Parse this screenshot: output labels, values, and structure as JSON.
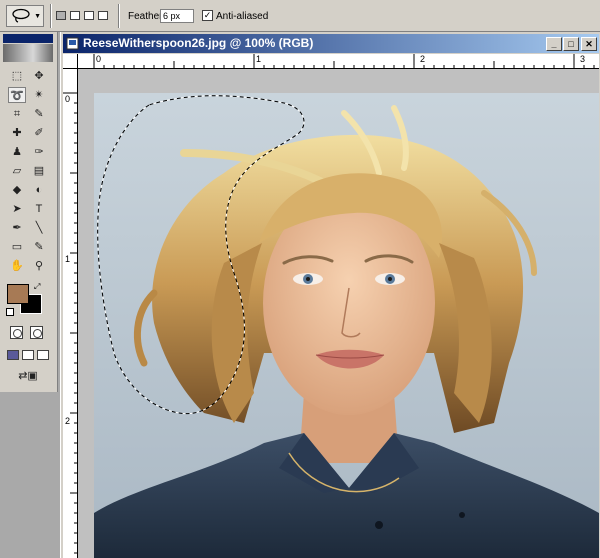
{
  "options_bar": {
    "feather_label": "Feather:",
    "feather_value": "6 px",
    "anti_aliased_label": "Anti-aliased",
    "anti_aliased_checked": true,
    "selection_modes": [
      "new-selection",
      "add-to-selection",
      "subtract-from-selection",
      "intersect-selection"
    ],
    "active_selection_mode": 0
  },
  "toolbox": {
    "tools": [
      {
        "name": "rectangular-marquee-tool",
        "glyph": "⬚"
      },
      {
        "name": "move-tool",
        "glyph": "✥"
      },
      {
        "name": "lasso-tool",
        "glyph": "➰"
      },
      {
        "name": "magic-wand-tool",
        "glyph": "✴"
      },
      {
        "name": "crop-tool",
        "glyph": "⌗"
      },
      {
        "name": "slice-tool",
        "glyph": "✎"
      },
      {
        "name": "healing-brush-tool",
        "glyph": "✚"
      },
      {
        "name": "brush-tool",
        "glyph": "✐"
      },
      {
        "name": "clone-stamp-tool",
        "glyph": "♟"
      },
      {
        "name": "history-brush-tool",
        "glyph": "✑"
      },
      {
        "name": "eraser-tool",
        "glyph": "▱"
      },
      {
        "name": "gradient-tool",
        "glyph": "▤"
      },
      {
        "name": "blur-tool",
        "glyph": "◆"
      },
      {
        "name": "dodge-tool",
        "glyph": "◐"
      },
      {
        "name": "path-selection-tool",
        "glyph": "➤"
      },
      {
        "name": "type-tool",
        "glyph": "T"
      },
      {
        "name": "pen-tool",
        "glyph": "✒"
      },
      {
        "name": "line-tool",
        "glyph": "╲"
      },
      {
        "name": "notes-tool",
        "glyph": "▭"
      },
      {
        "name": "eyedropper-tool",
        "glyph": "✎"
      },
      {
        "name": "hand-tool",
        "glyph": "✋"
      },
      {
        "name": "zoom-tool",
        "glyph": "⚲"
      }
    ],
    "selected_tool": "lasso-tool",
    "foreground_color": "#a77a55",
    "background_color": "#000000"
  },
  "document": {
    "title": "ReeseWitherspoon26.jpg @ 100% (RGB)",
    "minimize_glyph": "_",
    "maximize_glyph": "□",
    "close_glyph": "✕",
    "ruler_h_labels": [
      "0",
      "1",
      "2",
      "3"
    ],
    "ruler_v_labels": [
      "0",
      "1",
      "2"
    ]
  }
}
